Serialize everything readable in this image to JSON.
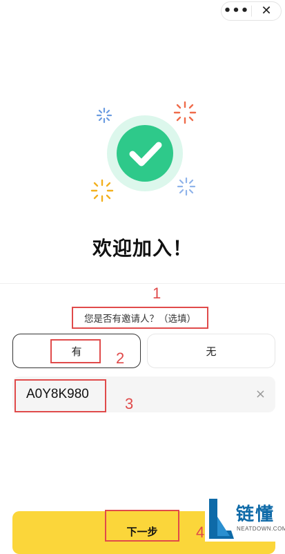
{
  "nav_capsule": {
    "more_glyph": "•••",
    "close_glyph": "✕"
  },
  "welcome_title": "欢迎加入！",
  "inviter_question": "您是否有邀请人？（选填）",
  "options": {
    "yes_label": "有",
    "no_label": "无"
  },
  "invite_code": {
    "value": "A0Y8K980",
    "clear_glyph": "×"
  },
  "next_button_label": "下一步",
  "annotations": [
    "1",
    "2",
    "3",
    "4"
  ],
  "watermark": {
    "brand": "链懂",
    "site": "NEATDOWN.COM"
  },
  "colors": {
    "accent_yellow": "#fbd63a",
    "success_green": "#2ec98a",
    "annotation_red": "#e04a4a"
  },
  "icons": {
    "hero": "check-circle-icon",
    "sparkles": [
      "sparkle-blue-icon",
      "sparkle-red-icon",
      "sparkle-yellow-icon",
      "sparkle-lightblue-icon"
    ]
  }
}
